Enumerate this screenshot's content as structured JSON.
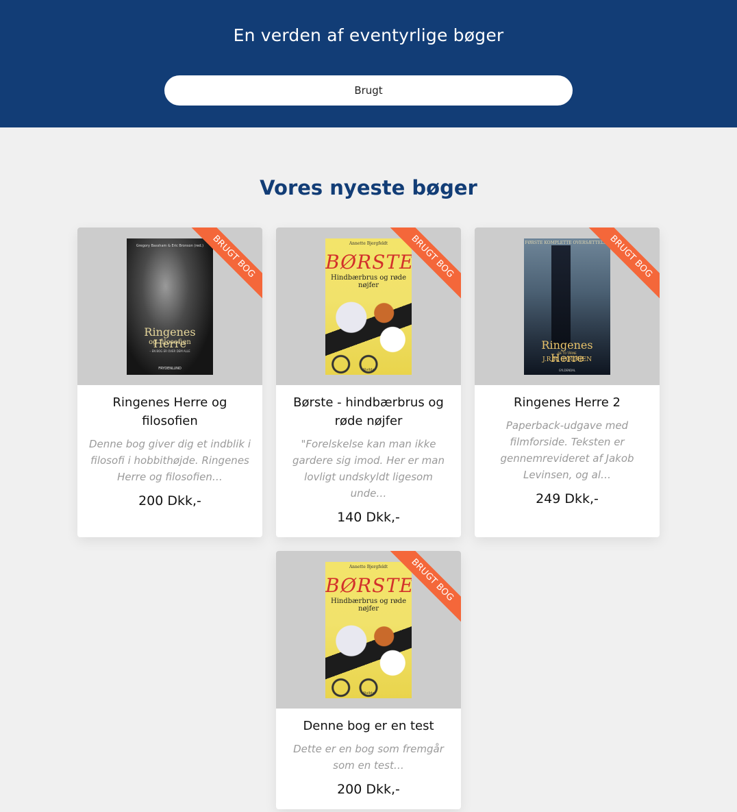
{
  "header": {
    "title": "En verden af eventyrlige bøger",
    "search_value": "Brugt"
  },
  "section": {
    "title": "Vores nyeste bøger"
  },
  "colors": {
    "header_bg": "#123d76",
    "ribbon": "#f4673a",
    "page_bg": "#f0f0f0"
  },
  "books": [
    {
      "ribbon": "BRUGT BOG",
      "title": "Ringenes Herre og filosofien",
      "description": "Denne bog giver dig et indblik i filosofi i hobbithøjde. Ringenes Herre og filosofien…",
      "price": "200 Dkk,-",
      "cover": {
        "top": "Gregory Bassham & Eric Bronson (red.)",
        "main": "Ringenes Herre",
        "sub": "og filosofien",
        "tag": "– EN BOG ER OVER DEM ALLE",
        "publisher": "FRYDENLUND"
      }
    },
    {
      "ribbon": "BRUGT BOG",
      "title": "Børste - hindbærbrus og røde nøjfer",
      "description": "\"Forelskelse kan man ikke gardere sig imod. Her er man lovligt undskyldt ligesom unde…",
      "price": "140 Dkk,-",
      "cover": {
        "author": "Annette Bjergfeldt",
        "main": "BØRSTE",
        "sub": "Hindbærbrus og røde nøjfer",
        "publisher": "Alvilda"
      }
    },
    {
      "ribbon": "BRUGT BOG",
      "title": "Ringenes Herre 2",
      "description": "Paperback-udgave med filmforside. Teksten er gennemrevideret af Jakob Levinsen, og al…",
      "price": "249 Dkk,-",
      "cover": {
        "top": "FØRSTE KOMPLETTE OVERSÆTTELSE",
        "main": "Ringenes Herre",
        "sub": "DE TO TÅRNE",
        "author": "J.R.R. TOLKIEN",
        "publisher": "GYLDENDAL"
      }
    },
    {
      "ribbon": "BRUGT BOG",
      "title": "Denne bog er en test",
      "description": "Dette er en bog som fremgår som en test…",
      "price": "200 Dkk,-",
      "cover": {
        "author": "Annette Bjergfeldt",
        "main": "BØRSTE",
        "sub": "Hindbærbrus og røde nøjfer",
        "publisher": "Alvilda"
      }
    }
  ]
}
